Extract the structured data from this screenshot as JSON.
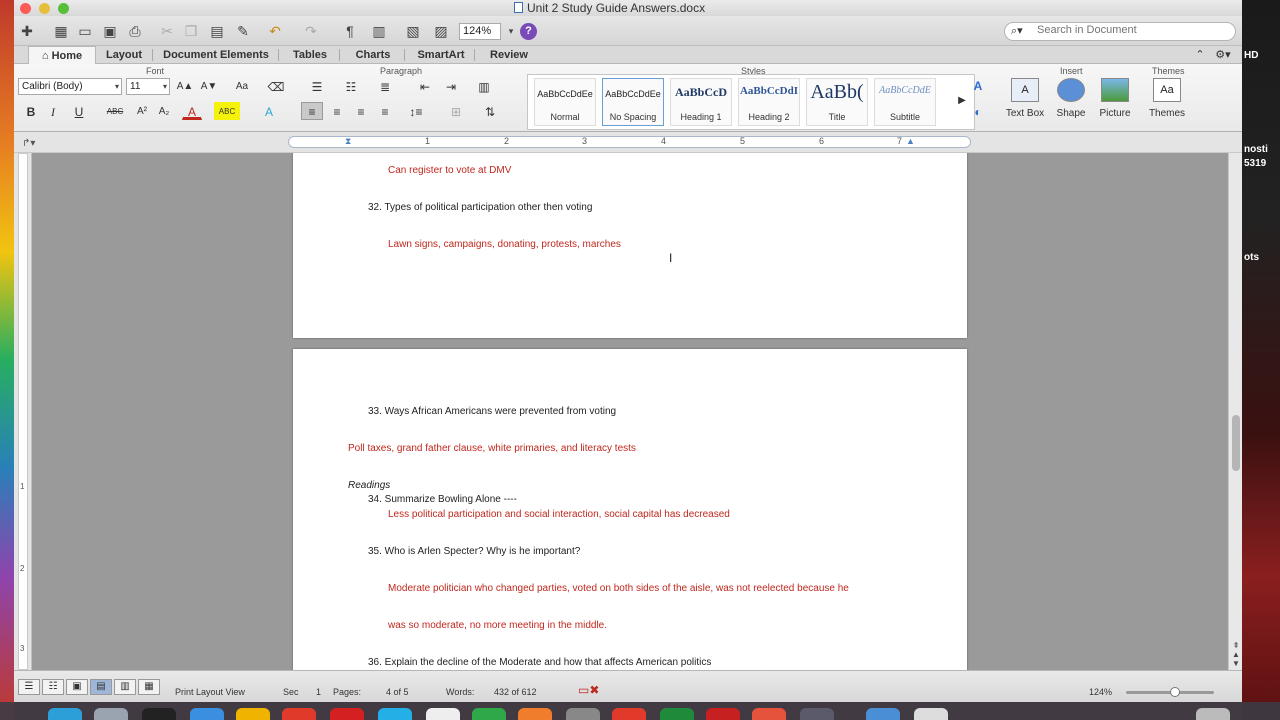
{
  "window": {
    "title": "Unit 2 Study Guide Answers.docx"
  },
  "toolbar": {
    "zoom_value": "124%",
    "search_placeholder": "Search in Document",
    "paragraph_mark": "¶",
    "help_label": "?"
  },
  "tabs": [
    {
      "label": "Home",
      "active": true
    },
    {
      "label": "Layout"
    },
    {
      "label": "Document Elements"
    },
    {
      "label": "Tables"
    },
    {
      "label": "Charts"
    },
    {
      "label": "SmartArt"
    },
    {
      "label": "Review"
    }
  ],
  "ribbon": {
    "groups": {
      "font": "Font",
      "paragraph": "Paragraph",
      "styles": "Styles",
      "insert": "Insert",
      "themes": "Themes"
    },
    "font_name": "Calibri (Body)",
    "font_size": "11",
    "format_buttons": {
      "bold": "B",
      "italic": "I",
      "underline": "U",
      "strike": "ABC",
      "superscript": "A²",
      "subscript": "A₂",
      "font_color": "A",
      "highlight": "ABC",
      "text_effects": "A"
    },
    "grow_font": "A▲",
    "shrink_font": "A▼",
    "change_case": "Aa",
    "styles": [
      {
        "sample": "AaBbCcDdEe",
        "name": "Normal"
      },
      {
        "sample": "AaBbCcDdEe",
        "name": "No Spacing",
        "selected": true
      },
      {
        "sample": "AaBbCcD",
        "name": "Heading 1"
      },
      {
        "sample": "AaBbCcDdI",
        "name": "Heading 2"
      },
      {
        "sample": "AaBb(",
        "name": "Title"
      },
      {
        "sample": "AaBbCcDdE",
        "name": "Subtitle"
      }
    ],
    "insert_buttons": {
      "text_box": "Text Box",
      "shape": "Shape",
      "picture": "Picture",
      "themes": "Themes"
    }
  },
  "ruler": {
    "numbers": [
      "1",
      "2",
      "3",
      "4",
      "5",
      "6",
      "7"
    ]
  },
  "vruler_numbers": [
    "1",
    "2",
    "3"
  ],
  "document": {
    "page1": [
      {
        "text": "Can register to vote at DMV",
        "kind": "a"
      },
      {
        "text": "32.  Types of political participation other then voting",
        "kind": "q"
      },
      {
        "text": "Lawn signs, campaigns, donating, protests, marches",
        "kind": "a"
      }
    ],
    "page2": [
      {
        "text": "33.  Ways African Americans were prevented from voting",
        "kind": "q"
      },
      {
        "text": "Poll taxes, grand father clause, white primaries, and literacy tests",
        "kind": "a"
      },
      {
        "text": "Readings",
        "kind": "it"
      },
      {
        "text": "34.  Summarize Bowling Alone ----",
        "kind": "q"
      },
      {
        "text": "Less political participation and social interaction, social capital has decreased",
        "kind": "a"
      },
      {
        "text": "35.  Who is Arlen Specter?  Why is he important?",
        "kind": "q"
      },
      {
        "text": "Moderate politician who changed parties, voted on both sides of the aisle, was not reelected because he",
        "kind": "a"
      },
      {
        "text": "was so moderate, no more meeting in the middle.",
        "kind": "a"
      },
      {
        "text": "36.  Explain the decline of the Moderate and how that affects American politics",
        "kind": "q"
      }
    ]
  },
  "status": {
    "view": "Print Layout View",
    "sec_label": "Sec",
    "sec_value": "1",
    "pages_label": "Pages:",
    "pages_value": "4 of 5",
    "words_label": "Words:",
    "words_value": "432 of 612",
    "zoom": "124%"
  },
  "desktop": {
    "hd_label": "HD",
    "side_text_1": "nosti",
    "side_text_2": "5319",
    "side_text_3": "ots"
  },
  "colors": {
    "answer_red": "#c0281e",
    "workspace": "#9a9a9a"
  }
}
